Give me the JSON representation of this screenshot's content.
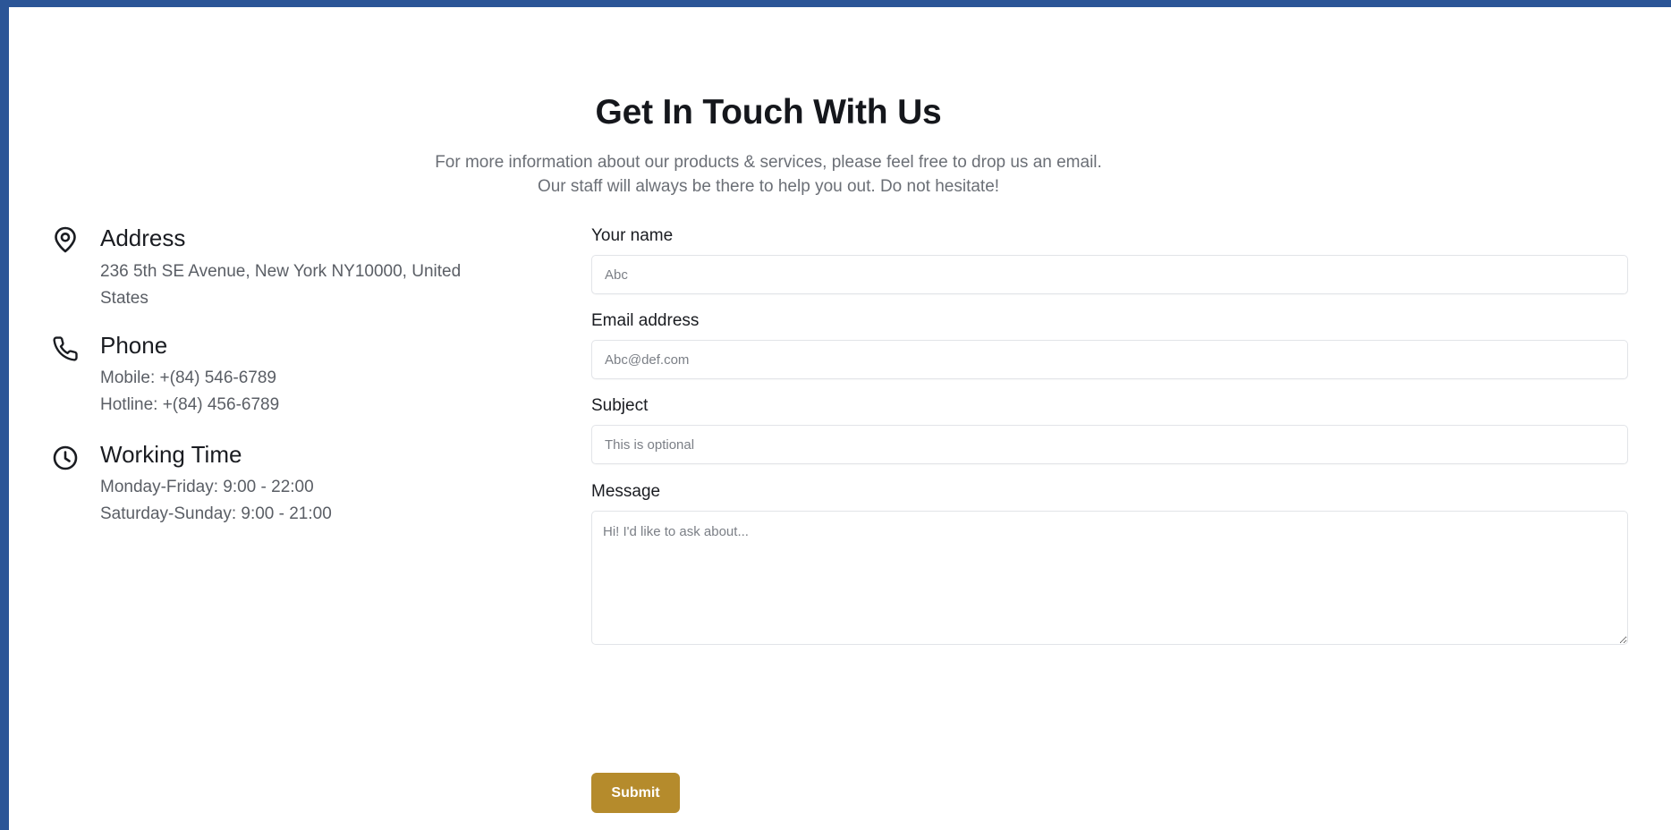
{
  "header": {
    "title": "Get In Touch With Us",
    "subtitle_line1": "For more information about our products & services, please feel free to drop us an email.",
    "subtitle_line2": "Our staff will always be there to help you out. Do not hesitate!"
  },
  "contact_info": {
    "address": {
      "icon": "location-pin-icon",
      "heading": "Address",
      "lines": [
        "236 5th SE Avenue, New York NY10000, United",
        "States"
      ]
    },
    "phone": {
      "icon": "phone-icon",
      "heading": "Phone",
      "lines": [
        "Mobile: +(84) 546-6789",
        "Hotline: +(84) 456-6789"
      ]
    },
    "working_time": {
      "icon": "clock-icon",
      "heading": "Working Time",
      "lines": [
        "Monday-Friday: 9:00 - 22:00",
        "Saturday-Sunday: 9:00 - 21:00"
      ]
    }
  },
  "form": {
    "name": {
      "label": "Your name",
      "placeholder": "Abc"
    },
    "email": {
      "label": "Email address",
      "placeholder": "Abc@def.com"
    },
    "subject": {
      "label": "Subject",
      "placeholder": "This is optional"
    },
    "message": {
      "label": "Message",
      "placeholder": "Hi! I'd like to ask about..."
    },
    "submit_label": "Submit"
  },
  "colors": {
    "frame_background": "#2b5597",
    "accent": "#b58b2c",
    "heading_text": "#15171c",
    "muted_text": "#6b6f76"
  }
}
